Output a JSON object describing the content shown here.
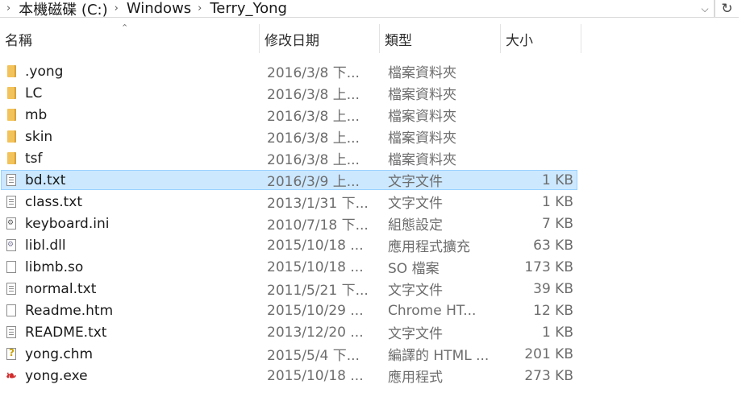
{
  "address_bar": {
    "crumbs": [
      "本機磁碟 (C:)",
      "Windows",
      "Terry_Yong"
    ]
  },
  "columns": {
    "name": "名稱",
    "date": "修改日期",
    "type": "類型",
    "size": "大小"
  },
  "files": [
    {
      "icon": "folder-icon",
      "name": ".yong",
      "date": "2016/3/8 下...",
      "type": "檔案資料夾",
      "size": ""
    },
    {
      "icon": "folder-icon",
      "name": "LC",
      "date": "2016/3/8 上...",
      "type": "檔案資料夾",
      "size": ""
    },
    {
      "icon": "folder-icon",
      "name": "mb",
      "date": "2016/3/8 上...",
      "type": "檔案資料夾",
      "size": ""
    },
    {
      "icon": "folder-icon",
      "name": "skin",
      "date": "2016/3/8 上...",
      "type": "檔案資料夾",
      "size": ""
    },
    {
      "icon": "folder-icon",
      "name": "tsf",
      "date": "2016/3/8 上...",
      "type": "檔案資料夾",
      "size": ""
    },
    {
      "icon": "text-file-icon",
      "name": "bd.txt",
      "date": "2016/3/9 上...",
      "type": "文字文件",
      "size": "1 KB",
      "selected": true
    },
    {
      "icon": "text-file-icon",
      "name": "class.txt",
      "date": "2013/1/31 下...",
      "type": "文字文件",
      "size": "1 KB"
    },
    {
      "icon": "config-file-icon",
      "name": "keyboard.ini",
      "date": "2010/7/18 下...",
      "type": "組態設定",
      "size": "7 KB"
    },
    {
      "icon": "dll-file-icon",
      "name": "libl.dll",
      "date": "2015/10/18 ...",
      "type": "應用程式擴充",
      "size": "63 KB"
    },
    {
      "icon": "blank-file-icon",
      "name": "libmb.so",
      "date": "2015/10/18 ...",
      "type": "SO 檔案",
      "size": "173 KB"
    },
    {
      "icon": "text-file-icon",
      "name": "normal.txt",
      "date": "2011/5/21 下...",
      "type": "文字文件",
      "size": "39 KB"
    },
    {
      "icon": "blank-file-icon",
      "name": "Readme.htm",
      "date": "2015/10/29 ...",
      "type": "Chrome HT...",
      "size": "12 KB"
    },
    {
      "icon": "text-file-icon",
      "name": "README.txt",
      "date": "2013/12/20 ...",
      "type": "文字文件",
      "size": "1 KB"
    },
    {
      "icon": "help-file-icon",
      "name": "yong.chm",
      "date": "2015/5/4 下...",
      "type": "編譯的 HTML ...",
      "size": "201 KB"
    },
    {
      "icon": "exe-icon",
      "name": "yong.exe",
      "date": "2015/10/18 ...",
      "type": "應用程式",
      "size": "273 KB"
    }
  ]
}
